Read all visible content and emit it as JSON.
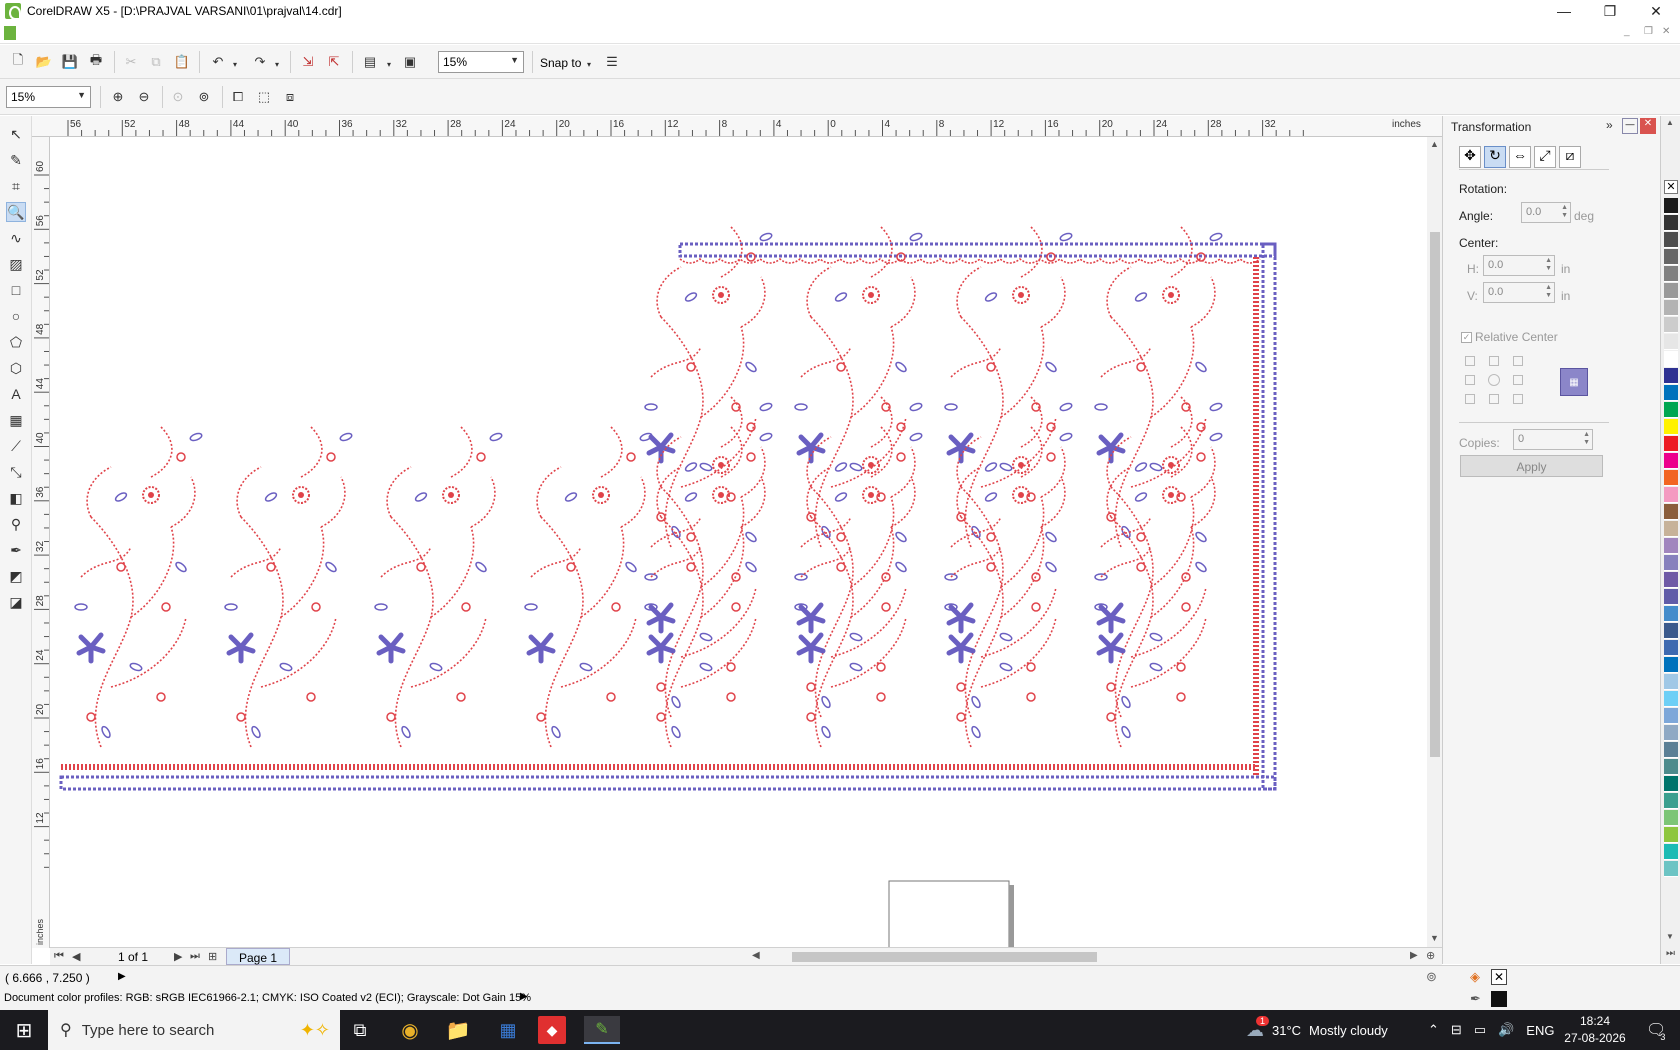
{
  "window": {
    "title": "CorelDRAW X5 - [D:\\PRAJVAL VARSANI\\01\\prajval\\14.cdr]",
    "controls": {
      "minimize": "—",
      "maximize": "❐",
      "close": "✕"
    }
  },
  "toolbar": {
    "zoom_value": "15%",
    "snap_label": "Snap to"
  },
  "propertybar": {
    "zoom_value": "15%"
  },
  "ruler": {
    "unit": "inches",
    "h_labels": [
      "56",
      "52",
      "48",
      "44",
      "40",
      "36",
      "32",
      "28",
      "24",
      "20",
      "16",
      "12",
      "8",
      "4",
      "0",
      "4",
      "8",
      "12",
      "16",
      "20",
      "24",
      "28",
      "32"
    ],
    "v_labels": [
      "60",
      "56",
      "52",
      "48",
      "44",
      "40",
      "36",
      "32",
      "28",
      "24",
      "20",
      "16",
      "12"
    ]
  },
  "pages": {
    "counter": "1 of 1",
    "current_tab": "Page 1"
  },
  "docker": {
    "title": "Transformation",
    "section": "Rotation:",
    "angle_label": "Angle:",
    "angle_value": "0.0",
    "angle_unit": "deg",
    "center_label": "Center:",
    "h_label": "H:",
    "h_value": "0.0",
    "h_unit": "in",
    "v_label": "V:",
    "v_value": "0.0",
    "v_unit": "in",
    "relative_center": "Relative Center",
    "copies_label": "Copies:",
    "copies_value": "0",
    "apply_label": "Apply"
  },
  "status": {
    "coords": "( 6.666 , 7.250 )",
    "profiles": "Document color profiles: RGB: sRGB IEC61966-2.1; CMYK: ISO Coated v2 (ECI); Grayscale: Dot Gain 15%"
  },
  "taskbar": {
    "search_placeholder": "Type here to search",
    "weather_temp": "31°C",
    "weather_desc": "Mostly cloudy",
    "notification_count": "1",
    "language": "ENG",
    "time": "18:24",
    "date": "27-08-2026",
    "action_center_badge": "3"
  },
  "palette_colors": [
    "#1a1a1a",
    "#333333",
    "#4d4d4d",
    "#666666",
    "#808080",
    "#999999",
    "#b3b3b3",
    "#cccccc",
    "#e6e6e6",
    "#ffffff",
    "#2e3192",
    "#0072bc",
    "#00a651",
    "#fff200",
    "#ed1c24",
    "#ec008c",
    "#f26522",
    "#f49ac1",
    "#8b5e3c",
    "#c7b299",
    "#a186be",
    "#8781bd",
    "#6f5aa6",
    "#605ca8",
    "#448ccb",
    "#3b5a8c",
    "#3e6ab0",
    "#0072bc",
    "#a0c8e6",
    "#6dcff6",
    "#7da7d9",
    "#8fa9c4",
    "#5b7f95",
    "#4d8b8c",
    "#00746b",
    "#3a9f8f",
    "#7cc576",
    "#8dc63f",
    "#1cbbb4",
    "#6cc4c4"
  ],
  "design_colors": {
    "red": "#e0434a",
    "blue": "#6a5fc1"
  }
}
